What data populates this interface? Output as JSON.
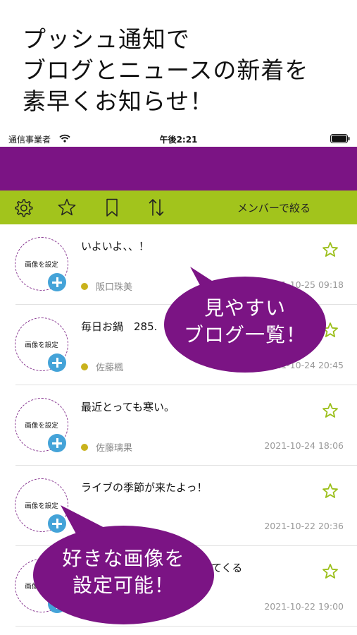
{
  "promo": {
    "line1": "プッシュ通知で",
    "line2": "ブログとニュースの新着を",
    "line3": "素早くお知らせ！"
  },
  "status_bar": {
    "carrier": "通信事業者",
    "time": "午後2:21"
  },
  "toolbar": {
    "icons": [
      "gear-icon",
      "star-icon",
      "bookmark-icon",
      "sort-icon"
    ],
    "filter_label": "メンバーで絞る"
  },
  "avatar_placeholder": "画像を設定",
  "posts": [
    {
      "title": "いよいよ、、！",
      "author": "阪口珠美",
      "date": "2021-10-25 09:18"
    },
    {
      "title": "毎日お鍋　285.",
      "author": "佐藤楓",
      "date": "2021-10-24 20:45"
    },
    {
      "title": "最近とっても寒い。",
      "author": "佐藤璃果",
      "date": "2021-10-24 18:06"
    },
    {
      "title": "ライブの季節が来たよっ！",
      "author": "",
      "date": "2021-10-22 20:36"
    },
    {
      "title": "てくる",
      "author": "",
      "date": "2021-10-22 19:00"
    }
  ],
  "callouts": {
    "blog_list_line1": "見やすい",
    "blog_list_line2": "ブログ一覧！",
    "image_line1": "好きな画像を",
    "image_line2": "設定可能！"
  },
  "colors": {
    "header_purple": "#7b1484",
    "toolbar_green": "#a2c41c",
    "star_green": "#9bbf1a",
    "author_dot": "#c9b21c",
    "plus_blue": "#44a3d8"
  }
}
